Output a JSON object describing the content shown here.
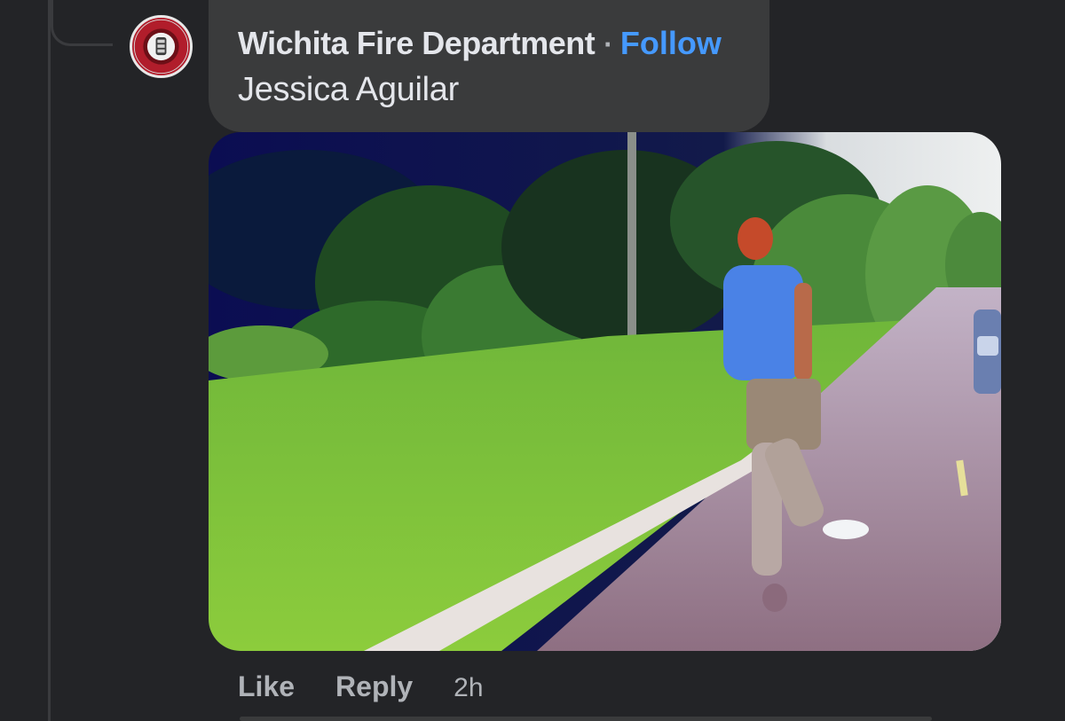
{
  "comment": {
    "author": "Wichita Fire Department",
    "separator": "·",
    "follow_label": "Follow",
    "text": "Jessica Aguilar",
    "attachment": {
      "type": "gif",
      "icon": "gif-image"
    }
  },
  "actions": {
    "like_label": "Like",
    "reply_label": "Reply",
    "timestamp": "2h"
  },
  "colors": {
    "background": "#232427",
    "bubble": "#3a3b3c",
    "text_primary": "#e4e6eb",
    "text_secondary": "#b0b3b8",
    "link": "#4599ff",
    "avatar_red": "#b11d2b"
  }
}
